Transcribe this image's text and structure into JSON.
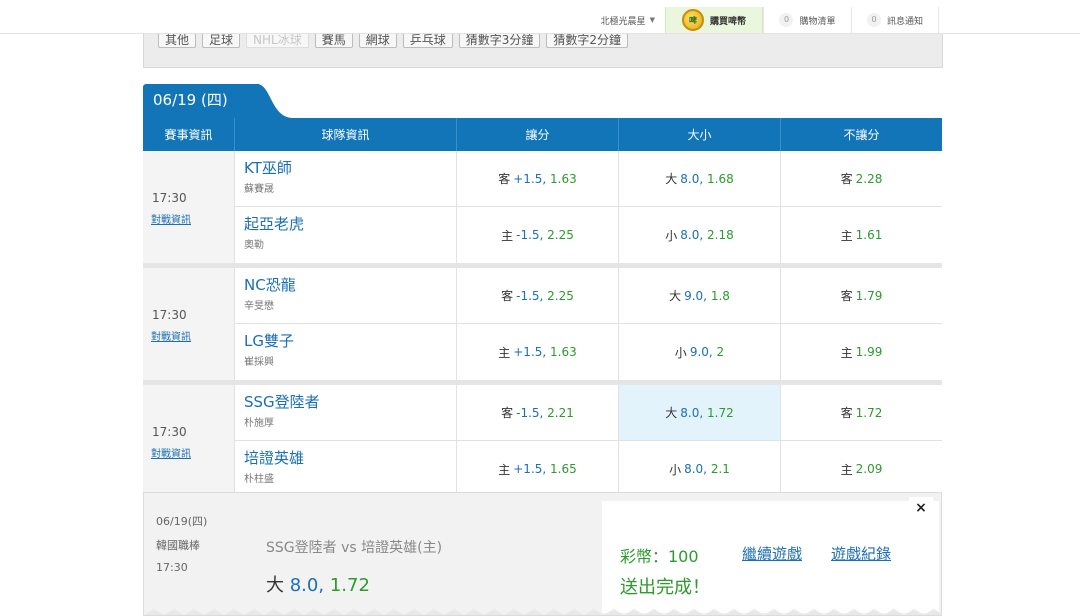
{
  "topbar": {
    "user_label": "北極光晨星",
    "buy_coin_label": "購買啤幣",
    "coin_icon_text": "啤",
    "cart_count": "0",
    "cart_label": "購物清單",
    "msg_count": "0",
    "msg_label": "訊息通知"
  },
  "categories": [
    "其他",
    "足球",
    "NHL冰球",
    "賽馬",
    "網球",
    "乒乓球",
    "猜數字3分鐘",
    "猜數字2分鐘"
  ],
  "date_tab": "06/19 (四)",
  "table": {
    "headers": [
      "賽事資訊",
      "球隊資訊",
      "讓分",
      "大小",
      "不讓分"
    ],
    "games": [
      {
        "time": "17:30",
        "vs_link": "對戰資訊",
        "rows": [
          {
            "team": "KT巫師",
            "pitcher": "蘇賽晟",
            "spread_tag": "客",
            "spread_line": "+1.5,",
            "spread_val": "1.63",
            "ou_tag": "大",
            "ou_line": "8.0,",
            "ou_val": "1.68",
            "ml_tag": "客",
            "ml_val": "2.28"
          },
          {
            "team": "起亞老虎",
            "pitcher": "奧勒",
            "spread_tag": "主",
            "spread_line": "-1.5,",
            "spread_val": "2.25",
            "ou_tag": "小",
            "ou_line": "8.0,",
            "ou_val": "2.18",
            "ml_tag": "主",
            "ml_val": "1.61"
          }
        ]
      },
      {
        "time": "17:30",
        "vs_link": "對戰資訊",
        "rows": [
          {
            "team": "NC恐龍",
            "pitcher": "辛旻懋",
            "spread_tag": "客",
            "spread_line": "-1.5,",
            "spread_val": "2.25",
            "ou_tag": "大",
            "ou_line": "9.0,",
            "ou_val": "1.8",
            "ml_tag": "客",
            "ml_val": "1.79"
          },
          {
            "team": "LG雙子",
            "pitcher": "崔採興",
            "spread_tag": "主",
            "spread_line": "+1.5,",
            "spread_val": "1.63",
            "ou_tag": "小",
            "ou_line": "9.0,",
            "ou_val": "2",
            "ml_tag": "主",
            "ml_val": "1.99"
          }
        ]
      },
      {
        "time": "17:30",
        "vs_link": "對戰資訊",
        "rows": [
          {
            "team": "SSG登陸者",
            "pitcher": "朴施厚",
            "spread_tag": "客",
            "spread_line": "-1.5,",
            "spread_val": "2.21",
            "ou_tag": "大",
            "ou_line": "8.0,",
            "ou_val": "1.72",
            "ml_tag": "客",
            "ml_val": "1.72"
          },
          {
            "team": "培證英雄",
            "pitcher": "朴柱盛",
            "spread_tag": "主",
            "spread_line": "+1.5,",
            "spread_val": "1.65",
            "ou_tag": "小",
            "ou_line": "8.0,",
            "ou_val": "2.1",
            "ml_tag": "主",
            "ml_val": "2.09"
          }
        ]
      }
    ]
  },
  "panel": {
    "date": "06/19(四)",
    "league": "韓國職棒",
    "time": "17:30",
    "match": "SSG登陸者 vs 培證英雄(主)",
    "pick_tag": "大",
    "pick_line": "8.0,",
    "pick_val": "1.72",
    "balance": "彩幣：100",
    "continue_label": "繼續遊戲",
    "history_label": "遊戲紀錄",
    "done_label": "送出完成！",
    "close_label": "×"
  },
  "colors": {
    "header_blue": "#1175b8",
    "link_blue": "#1a6fb5",
    "odds_green": "#2b9b2b",
    "selected_cell": "#e3f3fc"
  }
}
